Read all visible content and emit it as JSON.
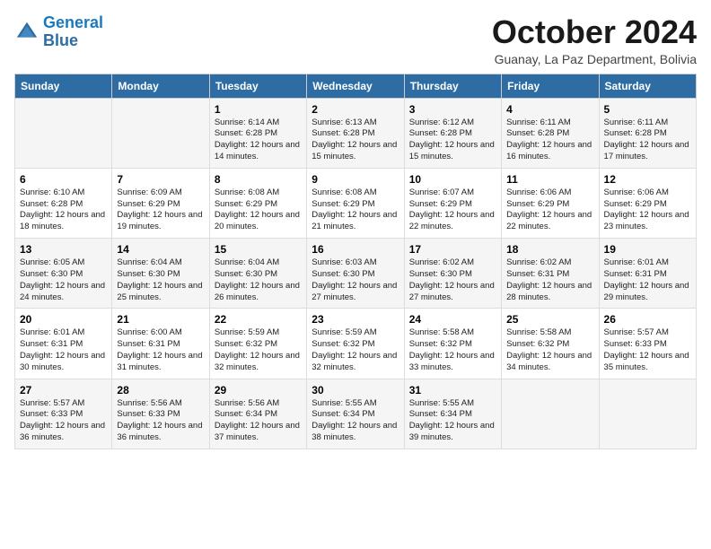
{
  "header": {
    "logo_text_general": "General",
    "logo_text_blue": "Blue",
    "month_title": "October 2024",
    "location": "Guanay, La Paz Department, Bolivia"
  },
  "days_of_week": [
    "Sunday",
    "Monday",
    "Tuesday",
    "Wednesday",
    "Thursday",
    "Friday",
    "Saturday"
  ],
  "weeks": [
    [
      {
        "day": "",
        "sunrise": "",
        "sunset": "",
        "daylight": ""
      },
      {
        "day": "",
        "sunrise": "",
        "sunset": "",
        "daylight": ""
      },
      {
        "day": "1",
        "sunrise": "Sunrise: 6:14 AM",
        "sunset": "Sunset: 6:28 PM",
        "daylight": "Daylight: 12 hours and 14 minutes."
      },
      {
        "day": "2",
        "sunrise": "Sunrise: 6:13 AM",
        "sunset": "Sunset: 6:28 PM",
        "daylight": "Daylight: 12 hours and 15 minutes."
      },
      {
        "day": "3",
        "sunrise": "Sunrise: 6:12 AM",
        "sunset": "Sunset: 6:28 PM",
        "daylight": "Daylight: 12 hours and 15 minutes."
      },
      {
        "day": "4",
        "sunrise": "Sunrise: 6:11 AM",
        "sunset": "Sunset: 6:28 PM",
        "daylight": "Daylight: 12 hours and 16 minutes."
      },
      {
        "day": "5",
        "sunrise": "Sunrise: 6:11 AM",
        "sunset": "Sunset: 6:28 PM",
        "daylight": "Daylight: 12 hours and 17 minutes."
      }
    ],
    [
      {
        "day": "6",
        "sunrise": "Sunrise: 6:10 AM",
        "sunset": "Sunset: 6:28 PM",
        "daylight": "Daylight: 12 hours and 18 minutes."
      },
      {
        "day": "7",
        "sunrise": "Sunrise: 6:09 AM",
        "sunset": "Sunset: 6:29 PM",
        "daylight": "Daylight: 12 hours and 19 minutes."
      },
      {
        "day": "8",
        "sunrise": "Sunrise: 6:08 AM",
        "sunset": "Sunset: 6:29 PM",
        "daylight": "Daylight: 12 hours and 20 minutes."
      },
      {
        "day": "9",
        "sunrise": "Sunrise: 6:08 AM",
        "sunset": "Sunset: 6:29 PM",
        "daylight": "Daylight: 12 hours and 21 minutes."
      },
      {
        "day": "10",
        "sunrise": "Sunrise: 6:07 AM",
        "sunset": "Sunset: 6:29 PM",
        "daylight": "Daylight: 12 hours and 22 minutes."
      },
      {
        "day": "11",
        "sunrise": "Sunrise: 6:06 AM",
        "sunset": "Sunset: 6:29 PM",
        "daylight": "Daylight: 12 hours and 22 minutes."
      },
      {
        "day": "12",
        "sunrise": "Sunrise: 6:06 AM",
        "sunset": "Sunset: 6:29 PM",
        "daylight": "Daylight: 12 hours and 23 minutes."
      }
    ],
    [
      {
        "day": "13",
        "sunrise": "Sunrise: 6:05 AM",
        "sunset": "Sunset: 6:30 PM",
        "daylight": "Daylight: 12 hours and 24 minutes."
      },
      {
        "day": "14",
        "sunrise": "Sunrise: 6:04 AM",
        "sunset": "Sunset: 6:30 PM",
        "daylight": "Daylight: 12 hours and 25 minutes."
      },
      {
        "day": "15",
        "sunrise": "Sunrise: 6:04 AM",
        "sunset": "Sunset: 6:30 PM",
        "daylight": "Daylight: 12 hours and 26 minutes."
      },
      {
        "day": "16",
        "sunrise": "Sunrise: 6:03 AM",
        "sunset": "Sunset: 6:30 PM",
        "daylight": "Daylight: 12 hours and 27 minutes."
      },
      {
        "day": "17",
        "sunrise": "Sunrise: 6:02 AM",
        "sunset": "Sunset: 6:30 PM",
        "daylight": "Daylight: 12 hours and 27 minutes."
      },
      {
        "day": "18",
        "sunrise": "Sunrise: 6:02 AM",
        "sunset": "Sunset: 6:31 PM",
        "daylight": "Daylight: 12 hours and 28 minutes."
      },
      {
        "day": "19",
        "sunrise": "Sunrise: 6:01 AM",
        "sunset": "Sunset: 6:31 PM",
        "daylight": "Daylight: 12 hours and 29 minutes."
      }
    ],
    [
      {
        "day": "20",
        "sunrise": "Sunrise: 6:01 AM",
        "sunset": "Sunset: 6:31 PM",
        "daylight": "Daylight: 12 hours and 30 minutes."
      },
      {
        "day": "21",
        "sunrise": "Sunrise: 6:00 AM",
        "sunset": "Sunset: 6:31 PM",
        "daylight": "Daylight: 12 hours and 31 minutes."
      },
      {
        "day": "22",
        "sunrise": "Sunrise: 5:59 AM",
        "sunset": "Sunset: 6:32 PM",
        "daylight": "Daylight: 12 hours and 32 minutes."
      },
      {
        "day": "23",
        "sunrise": "Sunrise: 5:59 AM",
        "sunset": "Sunset: 6:32 PM",
        "daylight": "Daylight: 12 hours and 32 minutes."
      },
      {
        "day": "24",
        "sunrise": "Sunrise: 5:58 AM",
        "sunset": "Sunset: 6:32 PM",
        "daylight": "Daylight: 12 hours and 33 minutes."
      },
      {
        "day": "25",
        "sunrise": "Sunrise: 5:58 AM",
        "sunset": "Sunset: 6:32 PM",
        "daylight": "Daylight: 12 hours and 34 minutes."
      },
      {
        "day": "26",
        "sunrise": "Sunrise: 5:57 AM",
        "sunset": "Sunset: 6:33 PM",
        "daylight": "Daylight: 12 hours and 35 minutes."
      }
    ],
    [
      {
        "day": "27",
        "sunrise": "Sunrise: 5:57 AM",
        "sunset": "Sunset: 6:33 PM",
        "daylight": "Daylight: 12 hours and 36 minutes."
      },
      {
        "day": "28",
        "sunrise": "Sunrise: 5:56 AM",
        "sunset": "Sunset: 6:33 PM",
        "daylight": "Daylight: 12 hours and 36 minutes."
      },
      {
        "day": "29",
        "sunrise": "Sunrise: 5:56 AM",
        "sunset": "Sunset: 6:34 PM",
        "daylight": "Daylight: 12 hours and 37 minutes."
      },
      {
        "day": "30",
        "sunrise": "Sunrise: 5:55 AM",
        "sunset": "Sunset: 6:34 PM",
        "daylight": "Daylight: 12 hours and 38 minutes."
      },
      {
        "day": "31",
        "sunrise": "Sunrise: 5:55 AM",
        "sunset": "Sunset: 6:34 PM",
        "daylight": "Daylight: 12 hours and 39 minutes."
      },
      {
        "day": "",
        "sunrise": "",
        "sunset": "",
        "daylight": ""
      },
      {
        "day": "",
        "sunrise": "",
        "sunset": "",
        "daylight": ""
      }
    ]
  ]
}
